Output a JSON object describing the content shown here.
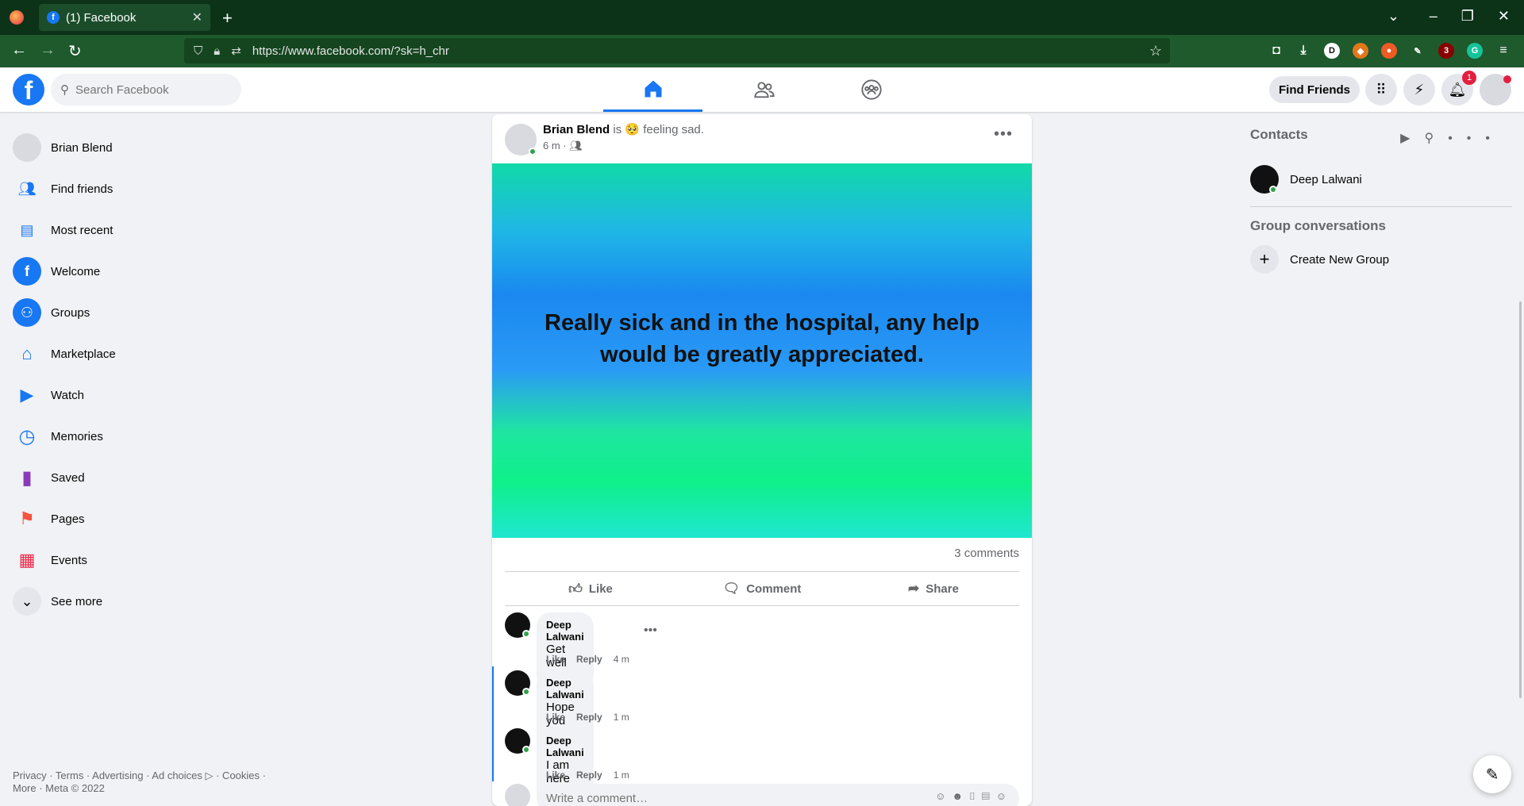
{
  "browser": {
    "tab_title": "(1) Facebook",
    "url": "https://www.facebook.com/?sk=h_chr",
    "ext_badge": "3"
  },
  "header": {
    "search_placeholder": "Search Facebook",
    "find_friends": "Find Friends",
    "notif_count": "1"
  },
  "sidebar": {
    "items": [
      {
        "label": "Brian Blend",
        "icon": "avatar-icon",
        "color": "#d8dadf"
      },
      {
        "label": "Find friends",
        "icon": "friends-icon",
        "color": "#1877f2"
      },
      {
        "label": "Most recent",
        "icon": "feed-icon",
        "color": "#1877f2"
      },
      {
        "label": "Welcome",
        "icon": "facebook-icon",
        "color": "#1877f2"
      },
      {
        "label": "Groups",
        "icon": "groups-icon",
        "color": "#1877f2"
      },
      {
        "label": "Marketplace",
        "icon": "marketplace-icon",
        "color": "#1877f2"
      },
      {
        "label": "Watch",
        "icon": "watch-icon",
        "color": "#1877f2"
      },
      {
        "label": "Memories",
        "icon": "memories-icon",
        "color": "#1877f2"
      },
      {
        "label": "Saved",
        "icon": "saved-icon",
        "color": "#8a3ab9"
      },
      {
        "label": "Pages",
        "icon": "pages-icon",
        "color": "#f7533e"
      },
      {
        "label": "Events",
        "icon": "events-icon",
        "color": "#f02849"
      },
      {
        "label": "See more",
        "icon": "chevron-down-icon",
        "color": "#e4e6eb"
      }
    ],
    "footer": "Privacy · Terms · Advertising · Ad choices ▷ · Cookies · More · Meta © 2022"
  },
  "post": {
    "author": "Brian Blend",
    "feeling": "is 🥺 feeling sad.",
    "time": "6 m ·",
    "text": "Really sick and in the hospital, any help would be greatly appreciated.",
    "comment_count": "3 comments",
    "like": "Like",
    "comment": "Comment",
    "share": "Share",
    "comments": [
      {
        "name": "Deep Lalwani",
        "text": "Get well soon",
        "like": "Like",
        "reply": "Reply",
        "time": "4 m"
      },
      {
        "name": "Deep Lalwani",
        "text": "Hope you feel better",
        "like": "Like",
        "reply": "Reply",
        "time": "1 m"
      },
      {
        "name": "Deep Lalwani",
        "text": "I am here for you",
        "like": "Like",
        "reply": "Reply",
        "time": "1 m"
      }
    ],
    "write_placeholder": "Write a comment…"
  },
  "contacts": {
    "title": "Contacts",
    "contact_name": "Deep Lalwani",
    "group_title": "Group conversations",
    "create_group": "Create New Group"
  }
}
